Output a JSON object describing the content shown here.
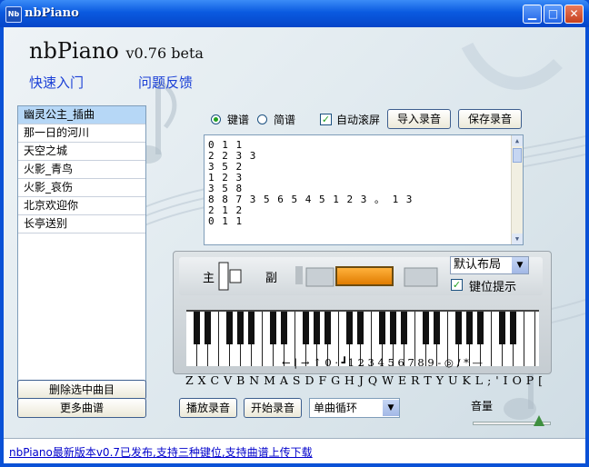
{
  "window": {
    "title": "nbPiano",
    "icon_text": "Nb",
    "controls": [
      "minimize-icon",
      "maximize-icon",
      "close-icon"
    ]
  },
  "header": {
    "app_name": "nbPiano",
    "version": "v0.76 beta",
    "links": {
      "quick_start": "快速入门",
      "feedback": "问题反馈"
    }
  },
  "songs": {
    "items": [
      "幽灵公主_插曲",
      "那一日的河川",
      "天空之城",
      "火影_青鸟",
      "火影_哀伤",
      "北京欢迎你",
      "长亭送别"
    ],
    "selected_index": 0,
    "delete_button": "删除选中曲目",
    "more_button": "更多曲谱"
  },
  "toolbar": {
    "mode_keyboard": "键谱",
    "mode_simple": "简谱",
    "selected_mode": "键谱",
    "auto_scroll": "自动滚屏",
    "auto_scroll_checked": true,
    "import_button": "导入录音",
    "save_button": "保存录音"
  },
  "score": {
    "lines": [
      "0 1 1",
      "2 2 3 3",
      "3 5 2",
      "1 2 3",
      "3 5 8",
      "8 8 7 3 5 6 5 4 5 1 2 3 。 1 3",
      "2 1 2",
      "0 1 1"
    ]
  },
  "keyboard": {
    "panel_main": "主",
    "panel_sub": "副",
    "layout_select": "默认布局",
    "key_hint_label": "键位提示",
    "key_hint_checked": true,
    "note_labels": "← | → ↑ 0 · ┛1 2 3 4 5 6 7 8 9 - ◎ / * —",
    "key_labels": "Z X C V B N M A S D F G H J Q W E R T Y U K L ; ' I O P ["
  },
  "controls": {
    "play_button": "播放录音",
    "record_button": "开始录音",
    "loop_select": "单曲循环",
    "volume_label": "音量",
    "volume_level": 0.85
  },
  "status": {
    "text": "nbPiano最新版本v0.7已发布,支持三种键位,支持曲谱上传下载"
  },
  "colors": {
    "titlebar": "#0a5ae0",
    "link": "#1a3fd6",
    "selection": "#b6d7f6",
    "lcd": "#ff9a1a"
  }
}
